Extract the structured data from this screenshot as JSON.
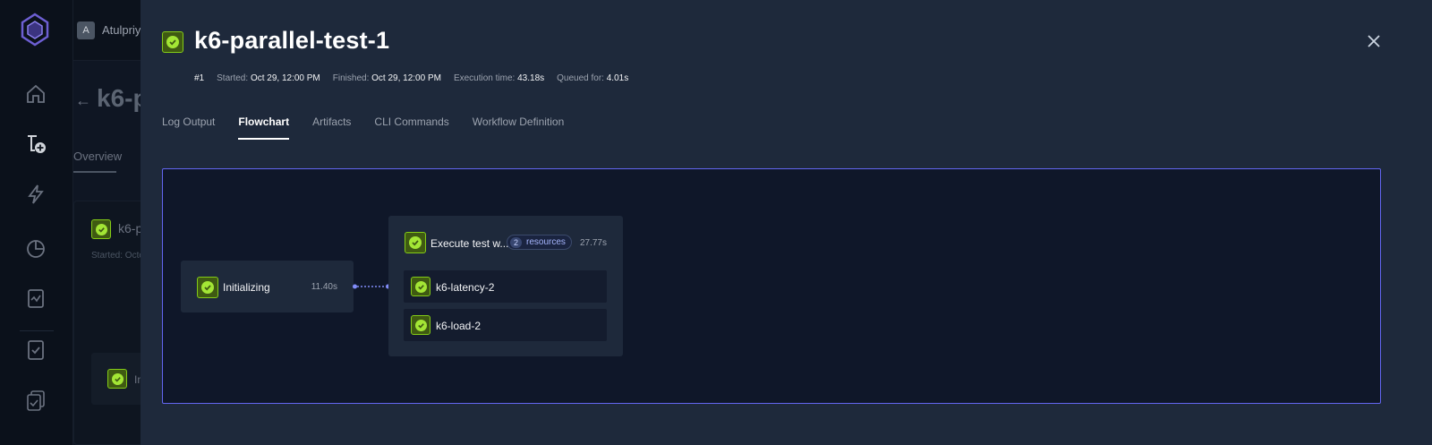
{
  "background": {
    "org_initial": "A",
    "org_name": "Atulpriya S",
    "page_title": "k6-p",
    "tab_overview": "Overview",
    "card_title": "k6-p",
    "card_subtitle": "Started: Octo",
    "node_label": "In"
  },
  "drawer": {
    "title": "k6-parallel-test-1",
    "status": "passed",
    "meta": {
      "run_number": "#1",
      "started_label": "Started:",
      "started_value": "Oct 29, 12:00 PM",
      "finished_label": "Finished:",
      "finished_value": "Oct 29, 12:00 PM",
      "execution_label": "Execution time:",
      "execution_value": "43.18s",
      "queued_label": "Queued for:",
      "queued_value": "4.01s"
    },
    "tabs": [
      {
        "label": "Log Output",
        "active": false
      },
      {
        "label": "Flowchart",
        "active": true
      },
      {
        "label": "Artifacts",
        "active": false
      },
      {
        "label": "CLI Commands",
        "active": false
      },
      {
        "label": "Workflow Definition",
        "active": false
      }
    ]
  },
  "flowchart": {
    "initializing": {
      "label": "Initializing",
      "duration": "11.40s"
    },
    "group": {
      "title": "Execute test w...",
      "resource_count": "2",
      "resource_label": "resources",
      "duration": "27.77s",
      "children": [
        {
          "label": "k6-latency-2"
        },
        {
          "label": "k6-load-2"
        }
      ]
    }
  },
  "colors": {
    "accent": "#6366f1",
    "success": "#a3e635",
    "drawer_bg": "#1e293b",
    "canvas_bg": "#0f1729"
  }
}
